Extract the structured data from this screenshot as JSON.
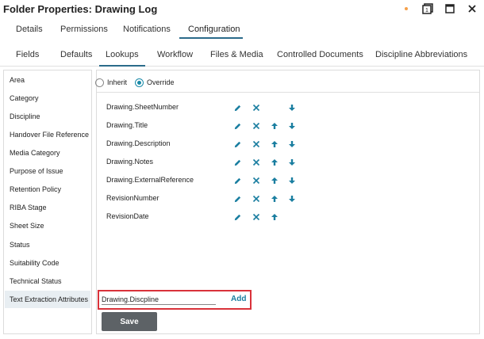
{
  "window": {
    "title": "Folder Properties: Drawing Log"
  },
  "tabs_top": [
    "Details",
    "Permissions",
    "Notifications",
    "Configuration"
  ],
  "tabs_sub": [
    "Fields",
    "Defaults",
    "Lookups",
    "Workflow",
    "Files & Media",
    "Controlled Documents",
    "Discipline Abbreviations"
  ],
  "sidebar": {
    "items": [
      "Area",
      "Category",
      "Discipline",
      "Handover File Reference",
      "Media Category",
      "Purpose of Issue",
      "Retention Policy",
      "RIBA Stage",
      "Sheet Size",
      "Status",
      "Suitability Code",
      "Technical Status",
      "Text Extraction Attributes"
    ],
    "selected": "Text Extraction Attributes"
  },
  "mode": {
    "inherit_label": "Inherit",
    "override_label": "Override",
    "selected": "Override"
  },
  "fields": [
    {
      "name": "Drawing.SheetNumber",
      "actions": [
        "edit",
        "remove",
        "down"
      ]
    },
    {
      "name": "Drawing.Title",
      "actions": [
        "edit",
        "remove",
        "up",
        "down"
      ]
    },
    {
      "name": "Drawing.Description",
      "actions": [
        "edit",
        "remove",
        "up",
        "down"
      ]
    },
    {
      "name": "Drawing.Notes",
      "actions": [
        "edit",
        "remove",
        "up",
        "down"
      ]
    },
    {
      "name": "Drawing.ExternalReference",
      "actions": [
        "edit",
        "remove",
        "up",
        "down"
      ]
    },
    {
      "name": "RevisionNumber",
      "actions": [
        "edit",
        "remove",
        "up",
        "down"
      ]
    },
    {
      "name": "RevisionDate",
      "actions": [
        "edit",
        "remove",
        "up"
      ]
    }
  ],
  "add": {
    "input_value": "Drawing.Discpline",
    "add_label": "Add"
  },
  "save_label": "Save",
  "colors": {
    "accent": "#1a7ea0",
    "highlight_border": "#d9323a",
    "save_bg": "#5d6266",
    "dot": "#f5a04a"
  }
}
